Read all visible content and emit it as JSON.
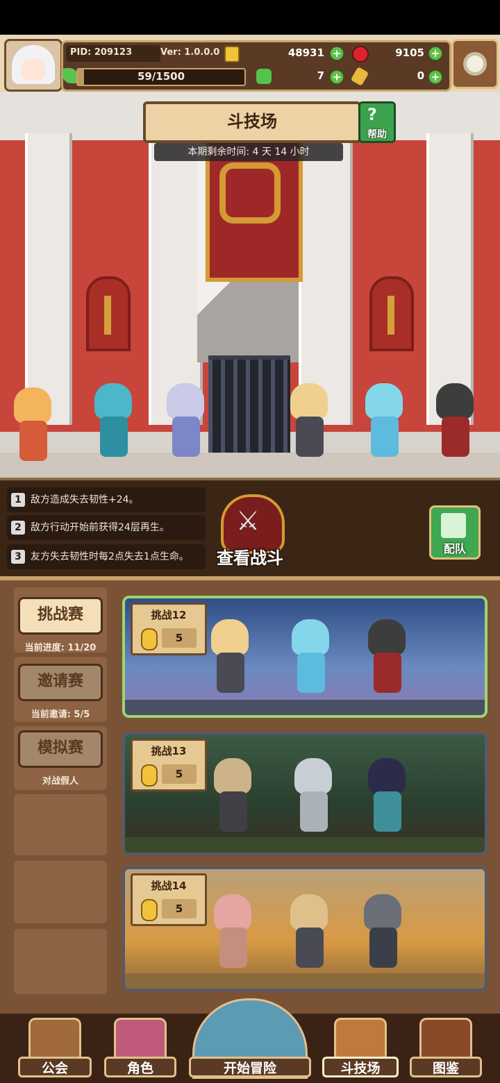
{
  "header": {
    "pid": "PID: 209123",
    "version": "Ver: 1.0.0.0",
    "gold": "48931",
    "gems": "9105",
    "stamina": "59/1500",
    "stamina_fraction": 0.039,
    "clover": "7",
    "keys": "0"
  },
  "arena": {
    "title": "斗技场",
    "help_label": "帮助",
    "timer": "本期剩余时间: 4 天 14 小时"
  },
  "rules": [
    {
      "num": "1",
      "text": "敌方造成失去韧性+24。"
    },
    {
      "num": "2",
      "text": "敌方行动开始前获得24层再生。"
    },
    {
      "num": "3",
      "text": "友方失去韧性时每2点失去1点生命。"
    }
  ],
  "actions": {
    "view_battle": "查看战斗",
    "team": "配队"
  },
  "modes": [
    {
      "label": "挑战赛",
      "sub": "当前进度: 11/20",
      "active": true
    },
    {
      "label": "邀请赛",
      "sub": "当前邀请: 5/5",
      "active": false
    },
    {
      "label": "模拟赛",
      "sub": "对战假人",
      "active": false
    }
  ],
  "challenges": [
    {
      "title": "挑战12",
      "cost": "5",
      "selected": true
    },
    {
      "title": "挑战13",
      "cost": "5",
      "selected": false
    },
    {
      "title": "挑战14",
      "cost": "5",
      "selected": false
    }
  ],
  "nav": [
    {
      "label": "公会"
    },
    {
      "label": "角色"
    },
    {
      "label": "开始冒险"
    },
    {
      "label": "斗技场"
    },
    {
      "label": "图鉴"
    }
  ]
}
